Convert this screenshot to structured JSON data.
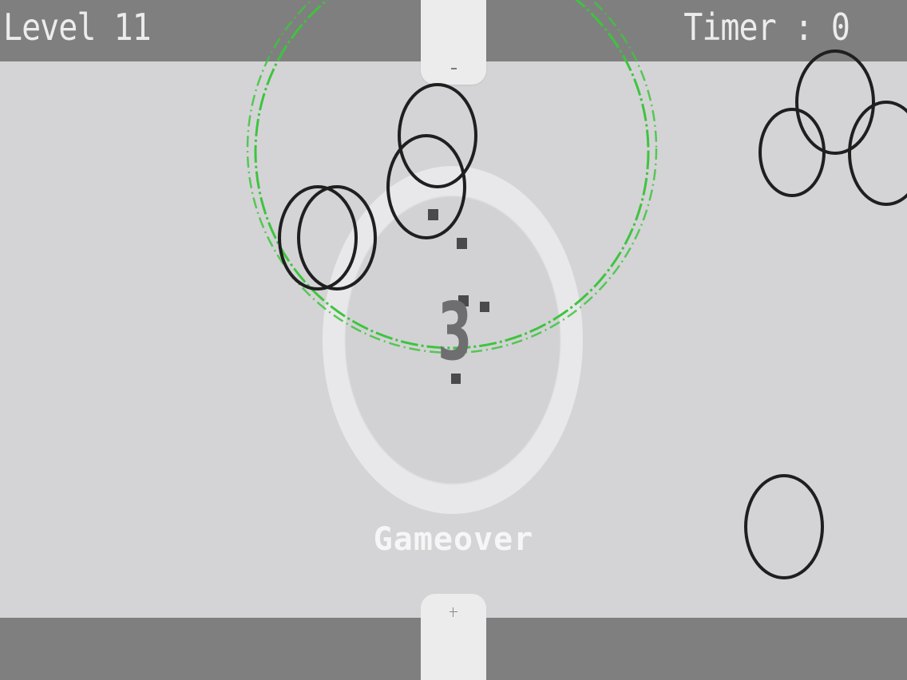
{
  "hud": {
    "level": "Level 11",
    "timer": "Timer : 0"
  },
  "countdown": "3",
  "status": "Gameover",
  "colors": {
    "bar": "#7f7f80",
    "field": "#d4d4d6",
    "ring": "#e8e8ea",
    "player_circle": "#3ec43e",
    "ball_outline": "#1f1f1f",
    "hud_text": "#ececec"
  },
  "icons": {
    "top_goal": "goal-top-icon",
    "bottom_goal": "goal-bottom-icon"
  }
}
